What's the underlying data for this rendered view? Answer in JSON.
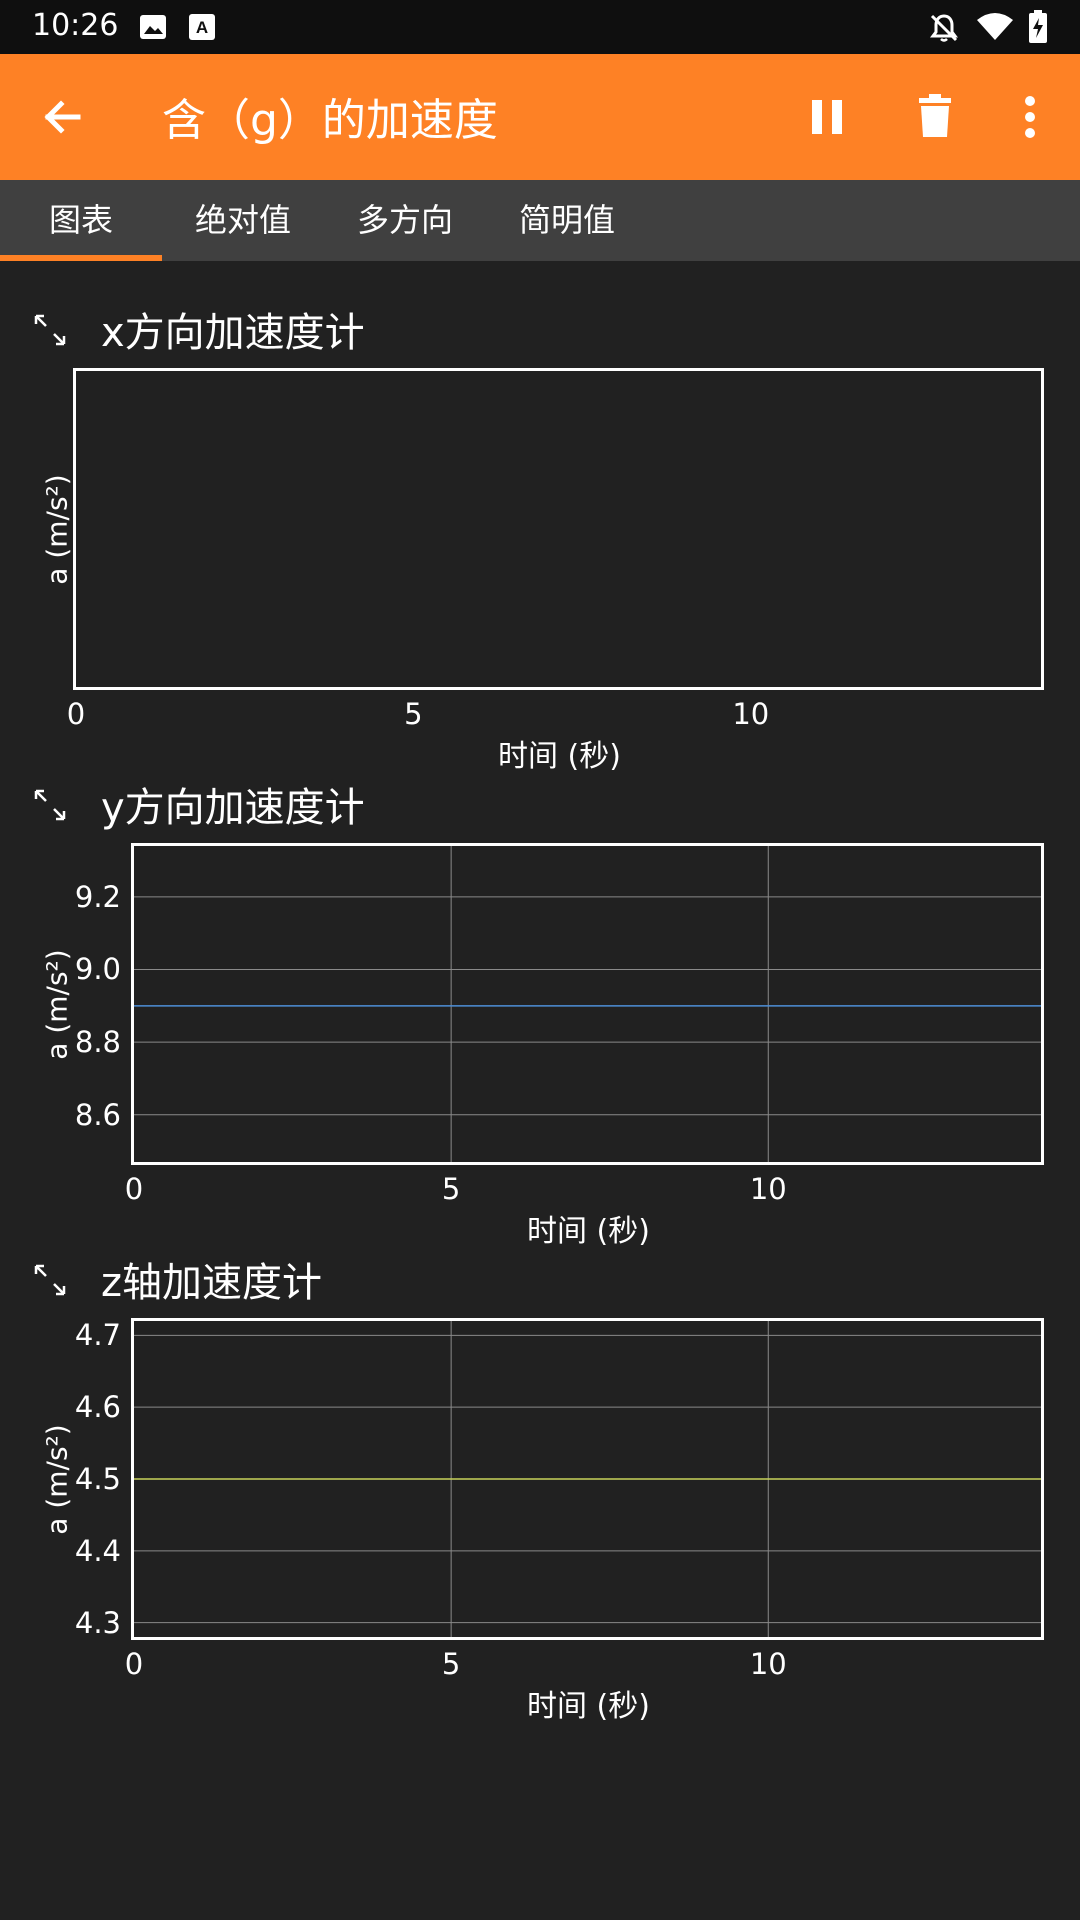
{
  "status_bar": {
    "time": "10:26",
    "icons": [
      "image-icon",
      "a-box-icon",
      "bell-off-icon",
      "wifi-icon",
      "battery-charging-icon"
    ]
  },
  "app_bar": {
    "title": "含（g）的加速度",
    "actions": [
      "pause-icon",
      "trash-icon",
      "more-vert-icon"
    ],
    "color": "#fe8125"
  },
  "tabs": [
    {
      "label": "图表",
      "selected": true
    },
    {
      "label": "绝对值",
      "selected": false
    },
    {
      "label": "多方向",
      "selected": false
    },
    {
      "label": "简明值",
      "selected": false
    }
  ],
  "chart_data": [
    {
      "type": "line",
      "title": "x方向加速度计",
      "xlabel": "时间 (秒)",
      "ylabel": "a (m/s²)",
      "x_ticks": [
        "0",
        "5",
        "10"
      ],
      "y_ticks": [],
      "xlim": [
        0,
        14.3
      ],
      "series": []
    },
    {
      "type": "line",
      "title": "y方向加速度计",
      "xlabel": "时间 (秒)",
      "ylabel": "a (m/s²)",
      "x_ticks": [
        "0",
        "5",
        "10"
      ],
      "y_ticks": [
        "9.2",
        "9.0",
        "8.8",
        "8.6"
      ],
      "xlim": [
        0,
        14.3
      ],
      "ylim": [
        8.47,
        9.34
      ],
      "grid": true,
      "series": [
        {
          "color": "#4e8fd8",
          "x": [
            0,
            14.3
          ],
          "y": [
            8.9,
            8.9
          ]
        }
      ]
    },
    {
      "type": "line",
      "title": "z轴加速度计",
      "xlabel": "时间 (秒)",
      "ylabel": "a (m/s²)",
      "x_ticks": [
        "0",
        "5",
        "10"
      ],
      "y_ticks": [
        "4.7",
        "4.6",
        "4.5",
        "4.4",
        "4.3"
      ],
      "xlim": [
        0,
        14.3
      ],
      "ylim": [
        4.28,
        4.72
      ],
      "grid": true,
      "series": [
        {
          "color": "#c8d35a",
          "x": [
            0,
            14.3
          ],
          "y": [
            4.5,
            4.5
          ]
        }
      ]
    }
  ]
}
